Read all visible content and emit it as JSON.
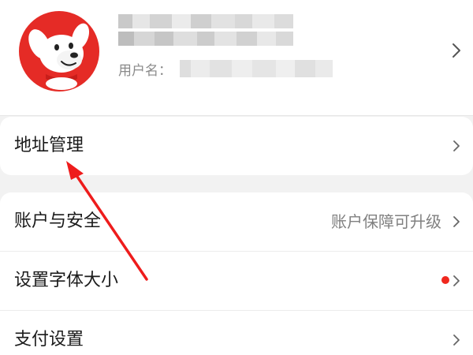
{
  "profile": {
    "username_label": "用户名：",
    "avatar_icon": "jd-dog-mascot-icon",
    "chevron_icon": "chevron-right-icon"
  },
  "menu": {
    "address": {
      "label": "地址管理"
    },
    "account": {
      "label": "账户与安全",
      "hint": "账户保障可升级"
    },
    "font_size": {
      "label": "设置字体大小"
    },
    "payment": {
      "label": "支付设置"
    }
  },
  "colors": {
    "accent_red": "#e52b26",
    "badge_red": "#f0281e",
    "annotation_arrow": "#ee1c1c"
  },
  "annotation": {
    "arrow_icon": "red-arrow-annotation"
  }
}
